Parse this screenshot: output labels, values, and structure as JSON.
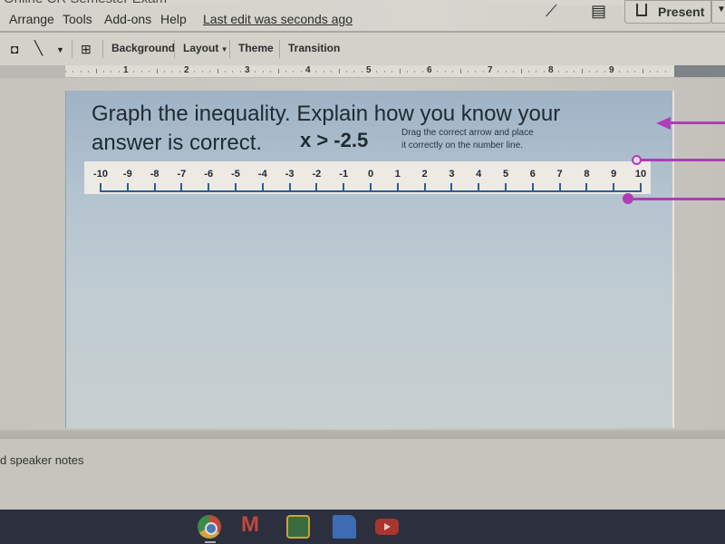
{
  "app": {
    "doc_title_partial": "Online CR Semester Exam"
  },
  "menubar": {
    "items": [
      "Arrange",
      "Tools",
      "Add-ons",
      "Help"
    ],
    "last_edit": "Last edit was seconds ago",
    "present_label": "Present",
    "icons": [
      "activity-trend-icon",
      "comments-icon",
      "present-play-icon",
      "present-dropdown-icon"
    ]
  },
  "toolbar": {
    "shape_icon": "shape-icon",
    "line_icon": "line-icon",
    "comment_icon": "add-comment-icon",
    "background_label": "Background",
    "layout_label": "Layout",
    "theme_label": "Theme",
    "transition_label": "Transition"
  },
  "ruler": {
    "numbers": [
      "1",
      "2",
      "3",
      "4",
      "5",
      "6",
      "7",
      "8",
      "9"
    ]
  },
  "slide": {
    "title": "Graph the inequality. Explain how you know your answer is correct.",
    "inequality": "x > -2.5",
    "instruction_line1": "Drag the correct arrow and place",
    "instruction_line2": "it correctly on the number line.",
    "number_line": {
      "labels": [
        "-10",
        "-9",
        "-8",
        "-7",
        "-6",
        "-5",
        "-4",
        "-3",
        "-2",
        "-1",
        "0",
        "1",
        "2",
        "3",
        "4",
        "5",
        "6",
        "7",
        "8",
        "9",
        "10"
      ],
      "min": -10,
      "max": 10
    },
    "draggable_arrows": [
      {
        "name": "left-arrow",
        "style": "arrowhead"
      },
      {
        "name": "open-circle-ray",
        "style": "open-dot"
      },
      {
        "name": "closed-circle-ray",
        "style": "closed-dot"
      }
    ],
    "accent_color": "#b03cb8",
    "numberline_color": "#2a5f96"
  },
  "notes": {
    "placeholder_partial": "d speaker notes"
  },
  "shelf": {
    "apps": [
      "chrome-icon",
      "gmail-icon",
      "google-classroom-icon",
      "google-docs-icon",
      "youtube-icon"
    ]
  }
}
